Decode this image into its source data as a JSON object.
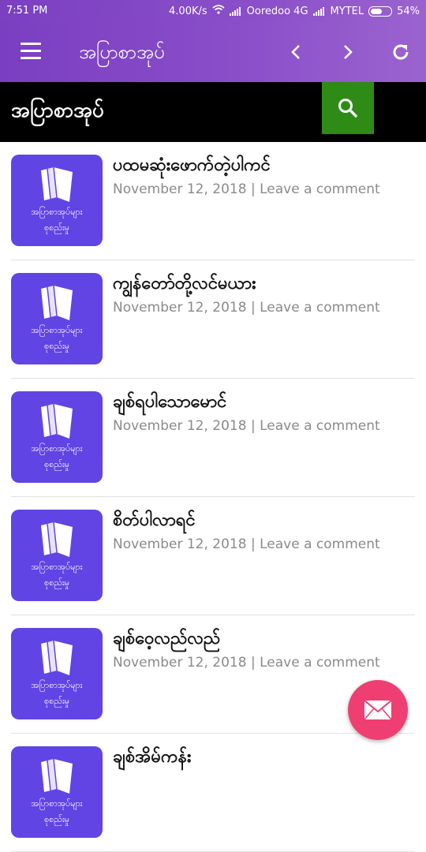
{
  "status": {
    "time": "7:51 PM",
    "speed": "4.00K/s",
    "carrier1": "Ooredoo 4G",
    "carrier2": "MYTEL",
    "battery": "54%"
  },
  "appbar": {
    "title": "အပြာစာအုပ်"
  },
  "search": {
    "heading": "အပြာစာအုပ်"
  },
  "thumb": {
    "caption_line1": "အပြာစာအုပ်များ",
    "caption_line2": "စုစည်းမှု"
  },
  "posts": [
    {
      "title": "ပထမဆုံးဖောက်တဲ့ပါကင်",
      "date": "November 12, 2018",
      "separator": "|",
      "comment": "Leave a comment"
    },
    {
      "title": "ကျွန်တော်တို့လင်မယား",
      "date": "November 12, 2018",
      "separator": "|",
      "comment": "Leave a comment"
    },
    {
      "title": "ချစ်ရပါသောမောင်",
      "date": "November 12, 2018",
      "separator": "|",
      "comment": "Leave a comment"
    },
    {
      "title": "စိတ်ပါလာရင်",
      "date": "November 12, 2018",
      "separator": "|",
      "comment": "Leave a comment"
    },
    {
      "title": "ချစ်ဝေ့လည်လည်",
      "date": "November 12, 2018",
      "separator": "|",
      "comment": "Leave a comment"
    },
    {
      "title": "ချစ်အိမ်ကန်း",
      "date": "",
      "separator": "",
      "comment": ""
    }
  ],
  "colors": {
    "appbar": "#8a4ec9",
    "search_button": "#2e8b16",
    "thumb": "#6144e4",
    "fab": "#ef3f72"
  },
  "icons": {
    "menu": "hamburger-icon",
    "prev": "chevron-left-icon",
    "next": "chevron-right-icon",
    "refresh": "refresh-icon",
    "search": "search-icon",
    "fab": "mail-icon"
  }
}
